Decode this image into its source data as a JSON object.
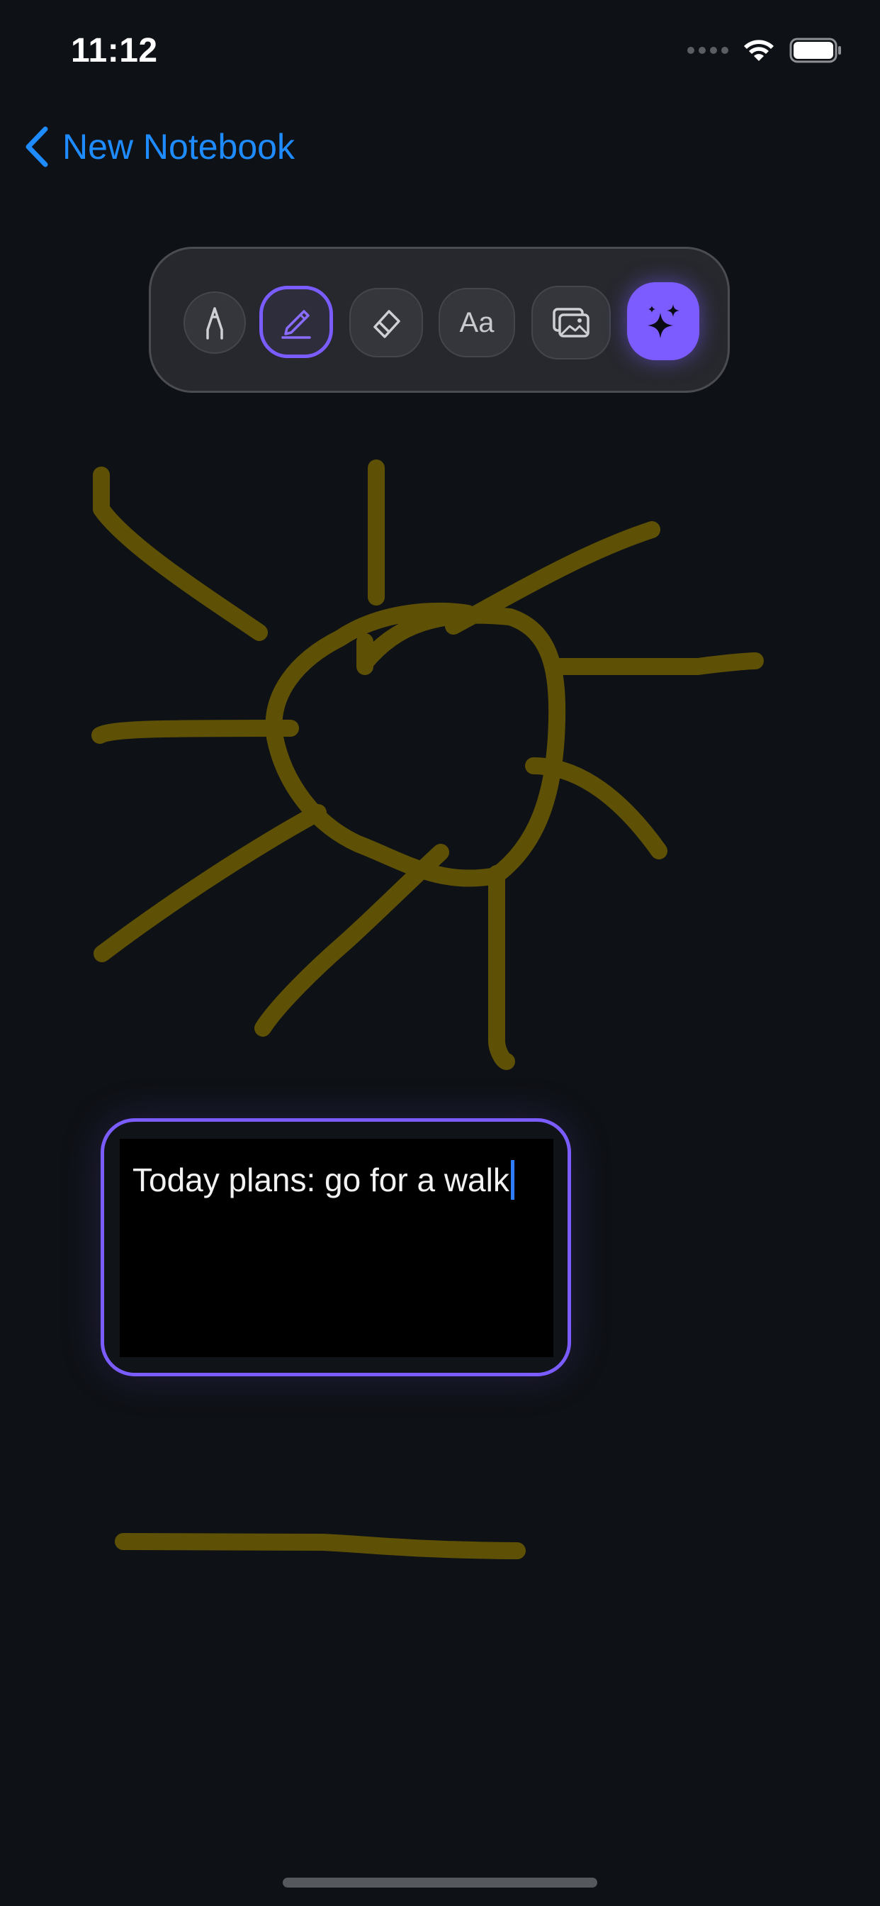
{
  "status_bar": {
    "time": "11:12"
  },
  "nav": {
    "back_label": "New Notebook",
    "accent_color": "#1e8bff"
  },
  "toolbar": {
    "tools": [
      {
        "name": "pen",
        "icon": "pen-nib-icon",
        "selected": false
      },
      {
        "name": "highlighter",
        "icon": "highlighter-icon",
        "selected": true
      },
      {
        "name": "eraser",
        "icon": "eraser-icon",
        "selected": false
      },
      {
        "name": "text",
        "icon": "text-icon",
        "label": "Aa",
        "selected": false
      },
      {
        "name": "image",
        "icon": "photos-icon",
        "selected": false
      },
      {
        "name": "ai",
        "icon": "sparkles-icon",
        "selected": false
      }
    ],
    "selected_color": "#7b5cff"
  },
  "canvas": {
    "ink_color": "#5e5106",
    "drawing": "sun-sketch"
  },
  "text_box": {
    "text": "Today plans: go for a walk"
  }
}
